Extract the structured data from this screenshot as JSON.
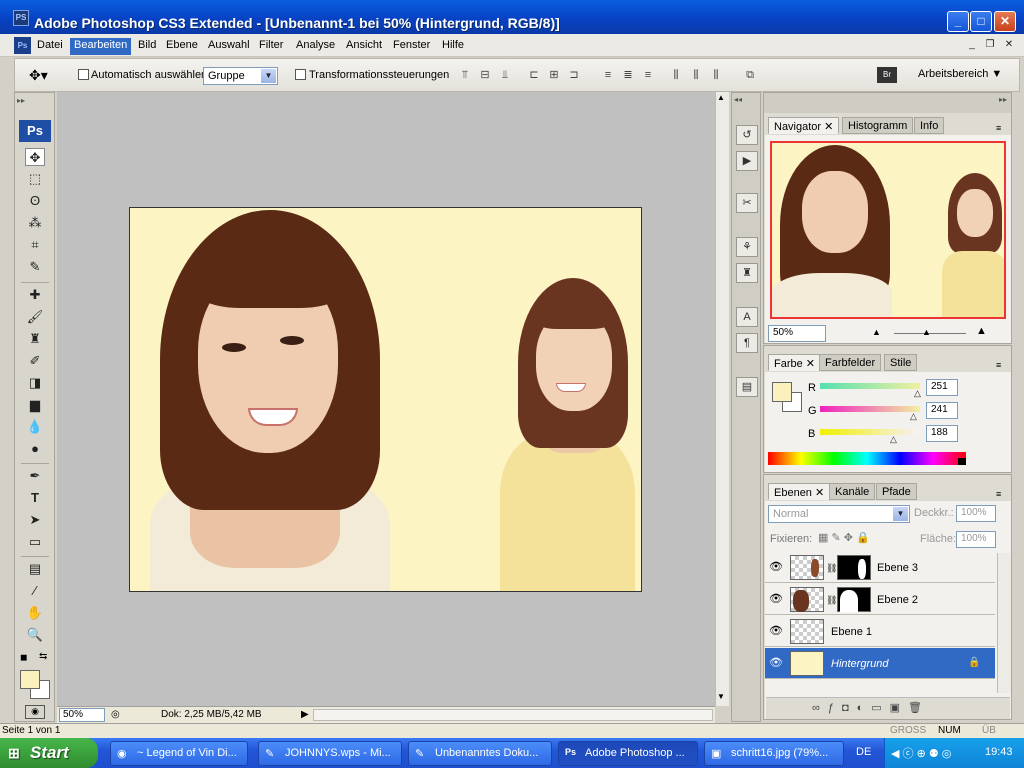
{
  "window": {
    "title": "Adobe Photoshop CS3 Extended - [Unbenannt-1 bei 50% (Hintergrund, RGB/8)]",
    "app_icon": "PS"
  },
  "menu": {
    "items": [
      "Datei",
      "Bearbeiten",
      "Bild",
      "Ebene",
      "Auswahl",
      "Filter",
      "Analyse",
      "Ansicht",
      "Fenster",
      "Hilfe"
    ],
    "active": "Bearbeiten"
  },
  "options": {
    "auto_select_label": "Automatisch auswählen:",
    "auto_select_value": "Gruppe",
    "transform_label": "Transformationssteuerungen",
    "workspace_label": "Arbeitsbereich"
  },
  "tools": {
    "logo": "Ps"
  },
  "colors": {
    "foreground": "#fbf1bc",
    "background": "#ffffff",
    "canvas_bg": "#fdf4c4"
  },
  "status": {
    "zoom": "50%",
    "doc": "Dok: 2,25 MB/5,42 MB",
    "page": "Seite 1 von 1"
  },
  "navigator": {
    "tabs": [
      "Navigator",
      "Histogramm",
      "Info"
    ],
    "zoom": "50%"
  },
  "color_panel": {
    "tabs": [
      "Farbe",
      "Farbfelder",
      "Stile"
    ],
    "r_label": "R",
    "r_value": "251",
    "g_label": "G",
    "g_value": "241",
    "b_label": "B",
    "b_value": "188"
  },
  "layers_panel": {
    "tabs": [
      "Ebenen",
      "Kanäle",
      "Pfade"
    ],
    "blend_mode": "Normal",
    "opacity_label": "Deckkr.:",
    "opacity_value": "100%",
    "lock_label": "Fixieren:",
    "fill_label": "Fläche:",
    "fill_value": "100%",
    "layers": [
      "Ebene 3",
      "Ebene 2",
      "Ebene 1",
      "Hintergrund"
    ]
  },
  "taskbar": {
    "start": "Start",
    "tasks": [
      "~ Legend of Vin Di...",
      "JOHNNYS.wps - Mi...",
      "Unbenanntes Doku...",
      "Adobe Photoshop ...",
      "schritt16.jpg (79%..."
    ],
    "language": "DE",
    "time": "19:43",
    "keys": [
      "GROSS",
      "NUM",
      "ÜB"
    ]
  }
}
